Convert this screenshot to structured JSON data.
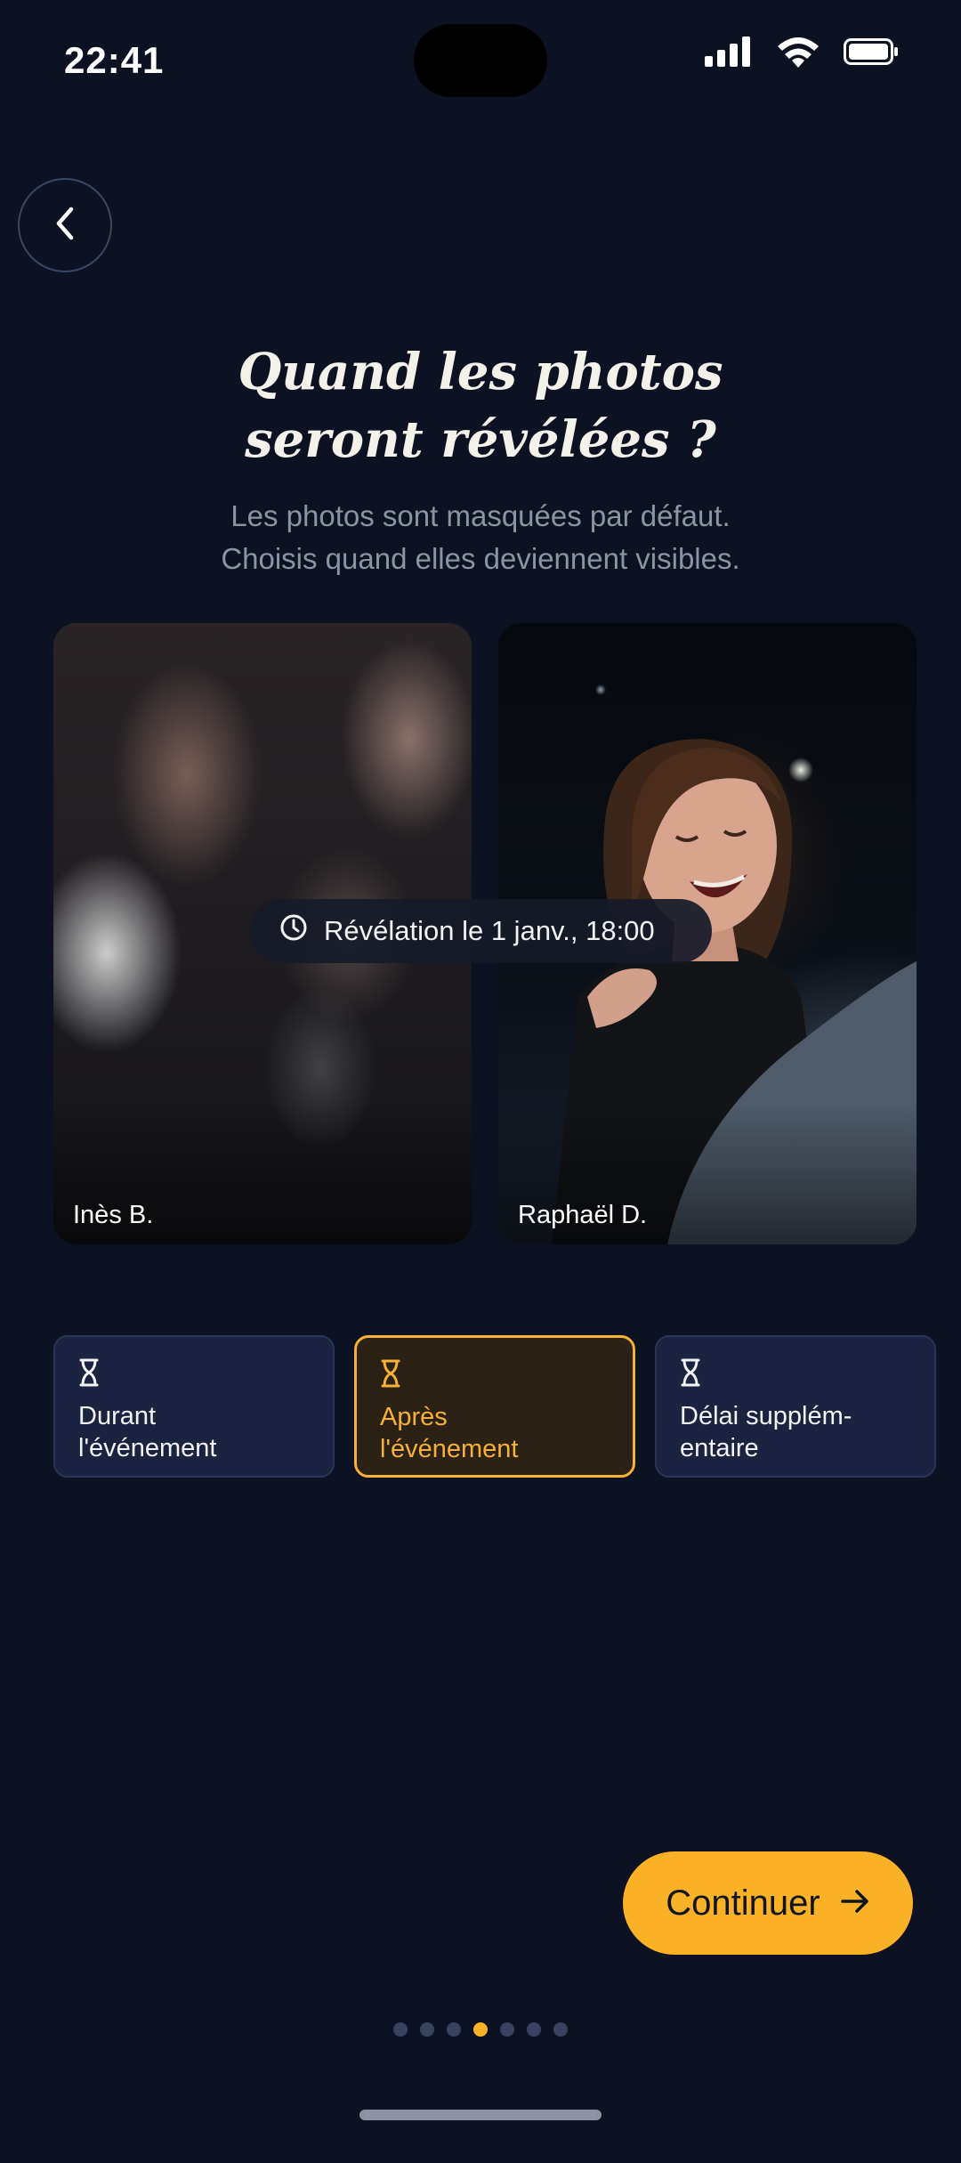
{
  "status_bar": {
    "time": "22:41",
    "icons": [
      "signal-icon",
      "wifi-icon",
      "battery-icon"
    ]
  },
  "header": {
    "back_icon": "chevron-left-icon",
    "title": "Quand les photos seront révélées ?",
    "subtitle_line1": "Les photos sont masquées par défaut.",
    "subtitle_line2": "Choisis quand elles deviennent visibles."
  },
  "photos": [
    {
      "name": "Inès B.",
      "state": "blurred"
    },
    {
      "name": "Raphaël D.",
      "state": "visible"
    }
  ],
  "reveal_badge": {
    "icon": "clock-icon",
    "text": "Révélation le 1 janv., 18:00"
  },
  "options": [
    {
      "icon": "hourglass-icon",
      "label": "Durant\nl'événement",
      "selected": false
    },
    {
      "icon": "hourglass-icon",
      "label": "Après\nl'événement",
      "selected": true
    },
    {
      "icon": "hourglass-icon",
      "label": "Délai supplém-\nentaire",
      "selected": false
    }
  ],
  "footer": {
    "continue_label": "Continuer",
    "continue_icon": "arrow-right-icon",
    "page_count": 7,
    "current_page": 4
  },
  "colors": {
    "background": "#0c1221",
    "accent": "#fbb125",
    "chip": "#1b2340",
    "chip_selected": "#2b2115"
  }
}
